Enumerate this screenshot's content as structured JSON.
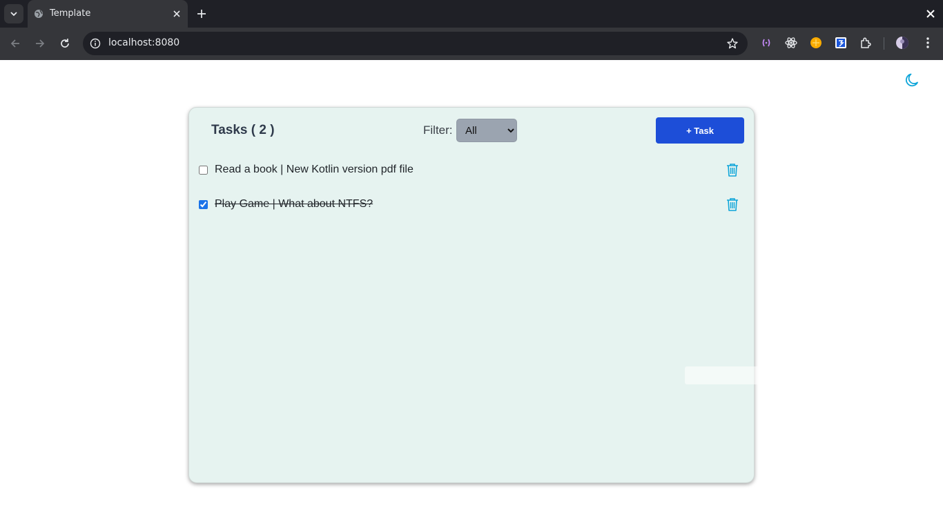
{
  "browser": {
    "tab_title": "Template",
    "url": "localhost:8080"
  },
  "app": {
    "title": "Tasks ( 2 )",
    "filter": {
      "label": "Filter:",
      "selected": "All",
      "options": [
        "All"
      ]
    },
    "add_button_label": "+ Task",
    "tasks": [
      {
        "text": "Read a book | New Kotlin version pdf file",
        "completed": false
      },
      {
        "text": "Play Game | What about NTFS?",
        "completed": true
      }
    ]
  },
  "colors": {
    "accent": "#1d4ed8",
    "icon": "#0ea5d9",
    "card_bg": "#e6f3f0"
  },
  "icons": {
    "theme_toggle": "moon-icon",
    "delete": "trash-icon"
  }
}
